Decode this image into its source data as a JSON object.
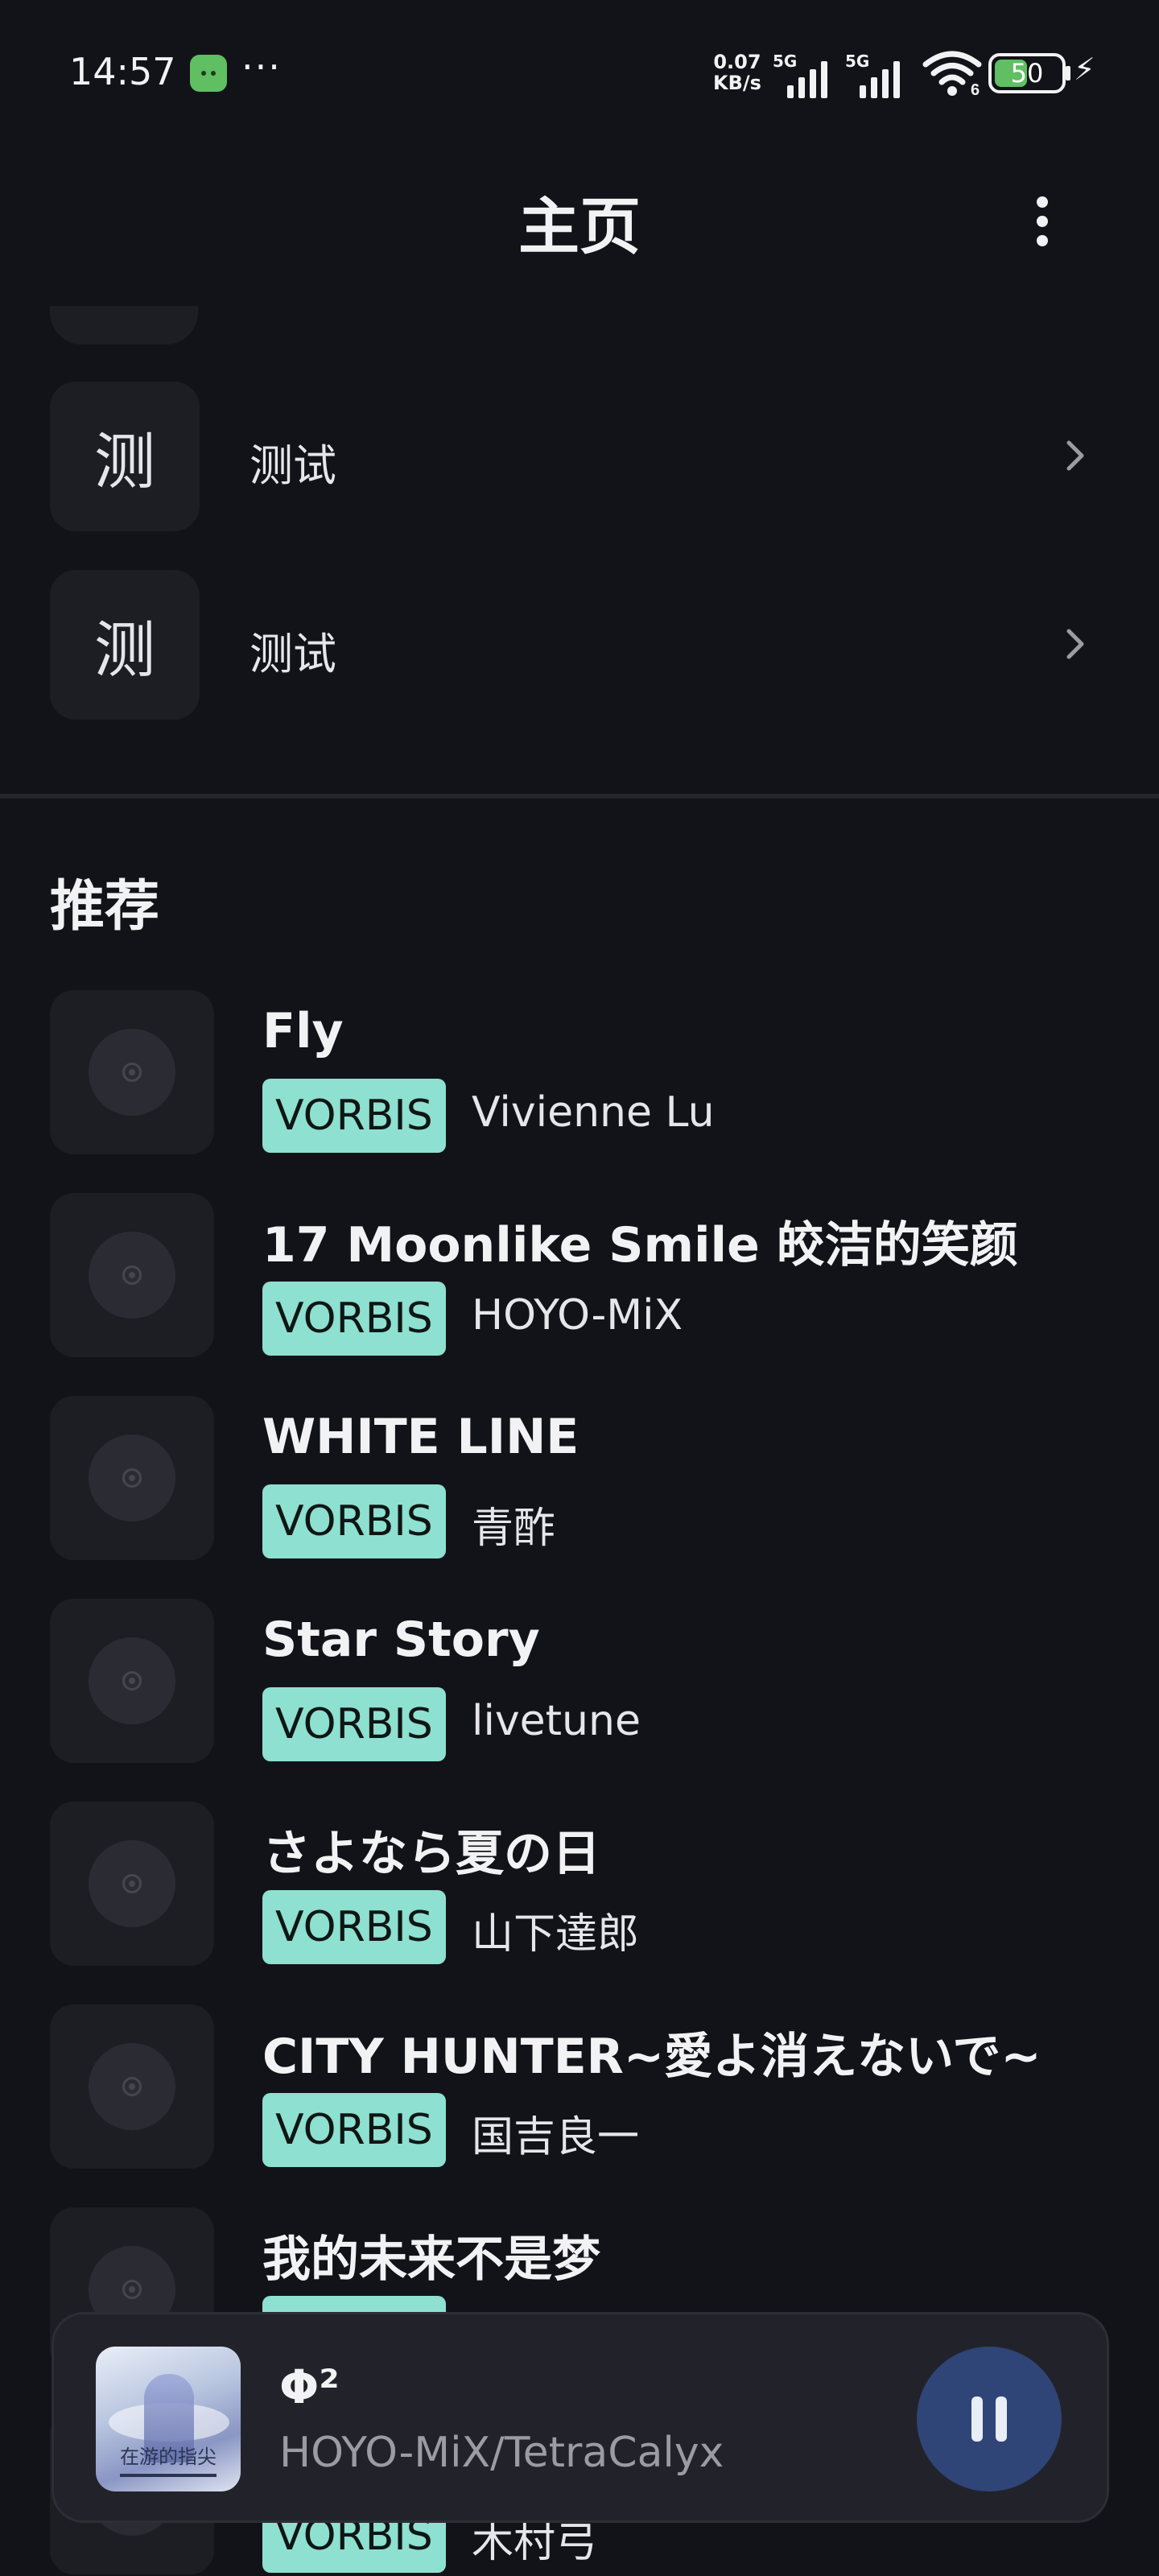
{
  "status_bar": {
    "time": "14:57",
    "overflow": "···",
    "net_speed_value": "0.07",
    "net_speed_unit": "KB/s",
    "sim1_label": "5G",
    "sim2_label": "5G",
    "wifi_label": "6",
    "battery": "50",
    "battery_level": 0.5,
    "battery_color": "#5fbf62"
  },
  "header": {
    "title": "主页",
    "more_icon": "more-vert-icon"
  },
  "menu": {
    "items": [
      {
        "avatar": "测",
        "label": "测试"
      },
      {
        "avatar": "测",
        "label": "测试"
      }
    ]
  },
  "recommend": {
    "title": "推荐",
    "songs": [
      {
        "title": "Fly",
        "format": "VORBIS",
        "artist": "Vivienne Lu"
      },
      {
        "title": "17 Moonlike Smile 皎洁的笑颜",
        "format": "VORBIS",
        "artist": "HOYO-MiX"
      },
      {
        "title": "WHITE LINE",
        "format": "VORBIS",
        "artist": "青酢"
      },
      {
        "title": "Star Story",
        "format": "VORBIS",
        "artist": "livetune"
      },
      {
        "title": "さよなら夏の日",
        "format": "VORBIS",
        "artist": "山下達郎"
      },
      {
        "title": "CITY HUNTER~愛よ消えないで~",
        "format": "VORBIS",
        "artist": "国吉良一"
      },
      {
        "title": "我的未来不是梦",
        "format": "VORBIS",
        "artist": ""
      },
      {
        "title": "",
        "format": "VORBIS",
        "artist": "木村弓"
      }
    ]
  },
  "player": {
    "title": "Φ²",
    "artist": "HOYO-MiX/TetraCalyx",
    "album_art_text": "在游的指尖",
    "state_icon": "pause-icon",
    "accent": "#2f4577"
  },
  "colors": {
    "background": "#121318",
    "surface": "#1d1e24",
    "badge": "#8ee0d1"
  }
}
